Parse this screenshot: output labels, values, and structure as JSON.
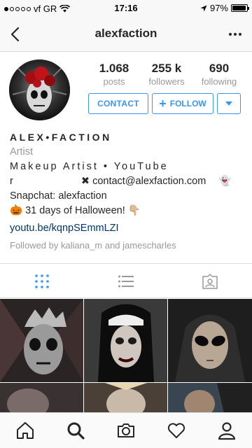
{
  "status_bar": {
    "carrier": "vf GR",
    "time": "17:16",
    "battery_percent": "97%",
    "battery_level": 0.97
  },
  "nav": {
    "title": "alexfaction",
    "back_icon": "chevron-left-icon",
    "more_icon": "more-horizontal-icon"
  },
  "stats": [
    {
      "value": "1.068",
      "label": "posts"
    },
    {
      "value": "255 k",
      "label": "followers"
    },
    {
      "value": "690",
      "label": "following"
    }
  ],
  "buttons": {
    "contact": "CONTACT",
    "follow": "FOLLOW",
    "dropdown_icon": "caret-down-icon"
  },
  "bio": {
    "name": "ALEX•FACTION",
    "category": "Artist",
    "line1": "Makeup Artist • YouTube",
    "line2_prefix": "r",
    "line2_contact": "✖ contact@alexfaction.com",
    "line2_emoji": "👻",
    "line3": "Snapchat: alexfaction",
    "line4": "🎃 31 days of Halloween! 👇🏼",
    "link": "youtu.be/kqnpSEmmLZI",
    "followed_by": "Followed by kaliana_m and jamescharles"
  },
  "tabs": [
    {
      "name": "grid-view-icon",
      "active": true
    },
    {
      "name": "list-view-icon",
      "active": false
    },
    {
      "name": "tagged-photos-icon",
      "active": false
    }
  ],
  "bottom_nav": [
    "home-icon",
    "search-icon",
    "camera-icon",
    "heart-icon",
    "profile-icon"
  ],
  "colors": {
    "accent": "#3897f0",
    "text": "#262626",
    "muted": "#999999",
    "link": "#003569"
  }
}
